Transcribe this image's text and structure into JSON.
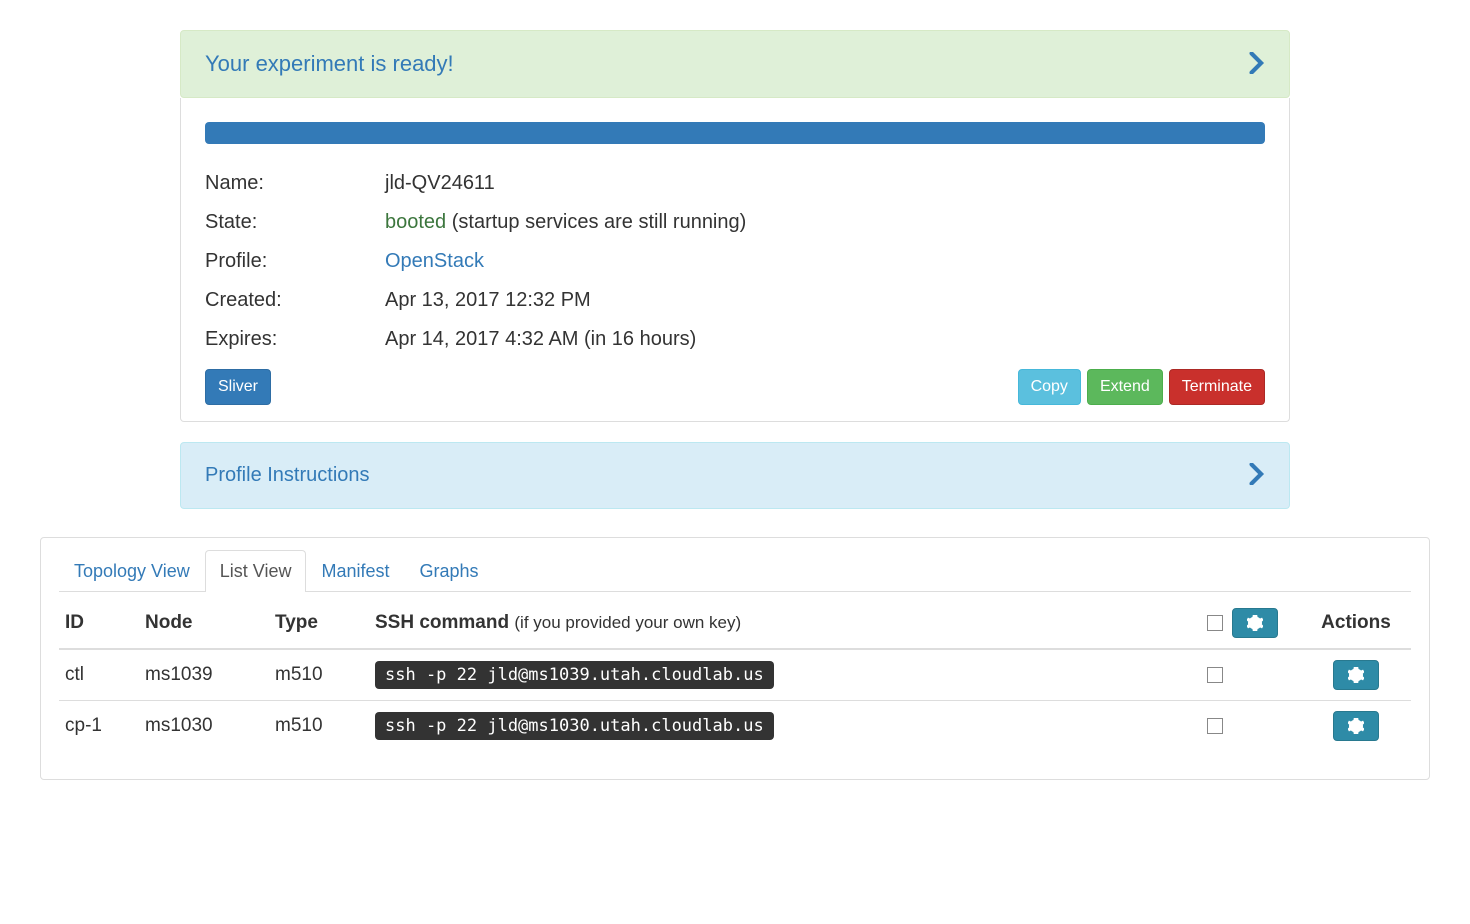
{
  "alert_success": {
    "title": "Your experiment is ready!"
  },
  "details": {
    "labels": {
      "name": "Name:",
      "state": "State:",
      "profile": "Profile:",
      "created": "Created:",
      "expires": "Expires:"
    },
    "name": "jld-QV24611",
    "state_status": "booted",
    "state_note": "(startup services are still running)",
    "profile": "OpenStack",
    "created": "Apr 13, 2017 12:32 PM",
    "expires": "Apr 14, 2017 4:32 AM (in 16 hours)"
  },
  "buttons": {
    "sliver": "Sliver",
    "copy": "Copy",
    "extend": "Extend",
    "terminate": "Terminate"
  },
  "profile_instructions": {
    "title": "Profile Instructions"
  },
  "tabs": {
    "topology": "Topology View",
    "list": "List View",
    "manifest": "Manifest",
    "graphs": "Graphs"
  },
  "table": {
    "headers": {
      "id": "ID",
      "node": "Node",
      "type": "Type",
      "ssh": "SSH command",
      "ssh_note": "(if you provided your own key)",
      "actions": "Actions"
    },
    "rows": [
      {
        "id": "ctl",
        "node": "ms1039",
        "type": "m510",
        "ssh": "ssh -p 22 jld@ms1039.utah.cloudlab.us"
      },
      {
        "id": "cp-1",
        "node": "ms1030",
        "type": "m510",
        "ssh": "ssh -p 22 jld@ms1030.utah.cloudlab.us"
      }
    ]
  }
}
